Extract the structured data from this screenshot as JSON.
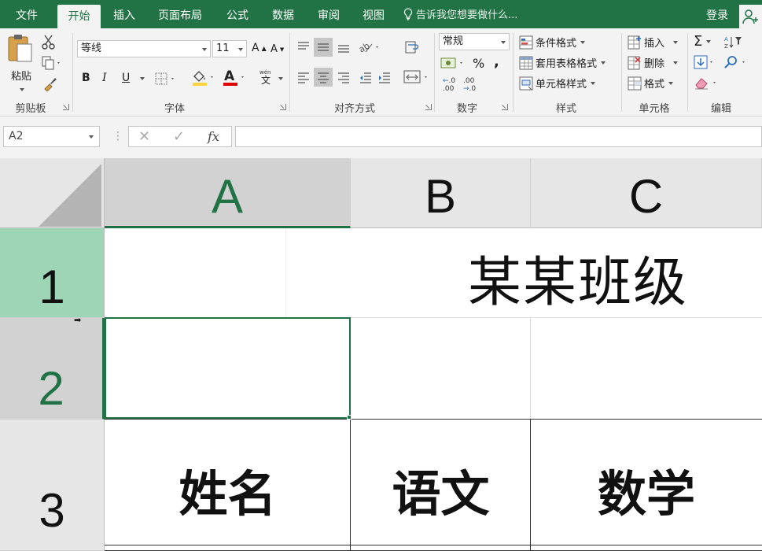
{
  "tabs": [
    {
      "label": "文件",
      "active": false
    },
    {
      "label": "开始",
      "active": true
    },
    {
      "label": "插入",
      "active": false
    },
    {
      "label": "页面布局",
      "active": false
    },
    {
      "label": "公式",
      "active": false
    },
    {
      "label": "数据",
      "active": false
    },
    {
      "label": "审阅",
      "active": false
    },
    {
      "label": "视图",
      "active": false
    }
  ],
  "tell_me": "告诉我您想要做什么...",
  "login": "登录",
  "ribbon": {
    "clipboard": {
      "paste": "粘贴",
      "label": "剪贴板"
    },
    "font": {
      "name": "等线",
      "size": "11",
      "label": "字体",
      "bold": "B",
      "italic": "I",
      "underline": "U",
      "grow": "A",
      "shrink": "A",
      "color": "A",
      "wen": "wén\n文"
    },
    "alignment": {
      "label": "对齐方式"
    },
    "number": {
      "format": "常规",
      "percent": "%",
      "comma": ",",
      "label": "数字",
      "inc": "←.0\n.00",
      "dec": ".00\n→.0"
    },
    "styles": {
      "conditional": "条件格式",
      "table": "套用表格格式",
      "cell": "单元格样式",
      "label": "样式"
    },
    "cells": {
      "insert": "插入",
      "delete": "删除",
      "format": "格式",
      "label": "单元格"
    },
    "editing": {
      "sum": "Σ",
      "sort": "A Z",
      "label": "编辑"
    }
  },
  "formula_bar": {
    "name_box": "A2",
    "cancel": "✕",
    "enter": "✓",
    "fx": "fx",
    "value": ""
  },
  "grid": {
    "columns": [
      "A",
      "B",
      "C"
    ],
    "rows": [
      "1",
      "2",
      "3"
    ],
    "title": "某某班级",
    "headers": [
      "姓名",
      "语文",
      "数学"
    ]
  },
  "colors": {
    "accent": "#217346",
    "row1_header": "#9fd5b7"
  }
}
